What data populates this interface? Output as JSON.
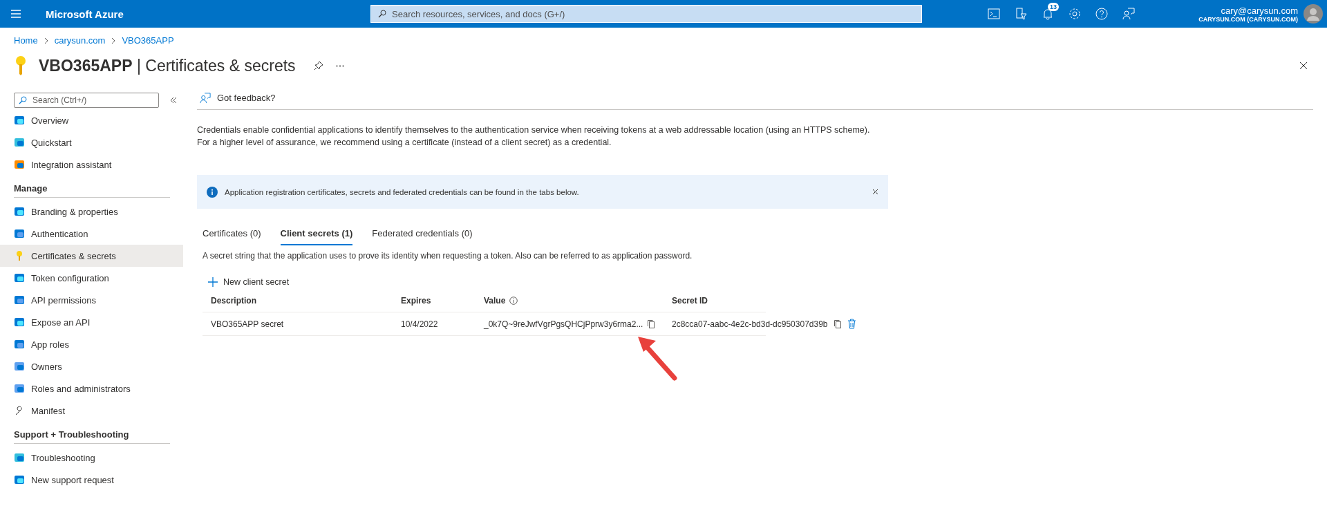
{
  "topbar": {
    "brand": "Microsoft Azure",
    "search_placeholder": "Search resources, services, and docs (G+/)",
    "notification_count": "13",
    "user": {
      "email": "cary@carysun.com",
      "tenant": "CARYSUN.COM (CARYSUN.COM)"
    }
  },
  "breadcrumb": [
    "Home",
    "carysun.com",
    "VBO365APP"
  ],
  "title": {
    "app": "VBO365APP",
    "separator": "|",
    "page": "Certificates & secrets"
  },
  "sidebar": {
    "search_placeholder": "Search (Ctrl+/)",
    "groups": [
      {
        "items": [
          {
            "label": "Overview",
            "selected": false
          },
          {
            "label": "Quickstart",
            "selected": false
          },
          {
            "label": "Integration assistant",
            "selected": false
          }
        ]
      },
      {
        "heading": "Manage",
        "items": [
          {
            "label": "Branding & properties",
            "selected": false
          },
          {
            "label": "Authentication",
            "selected": false
          },
          {
            "label": "Certificates & secrets",
            "selected": true
          },
          {
            "label": "Token configuration",
            "selected": false
          },
          {
            "label": "API permissions",
            "selected": false
          },
          {
            "label": "Expose an API",
            "selected": false
          },
          {
            "label": "App roles",
            "selected": false
          },
          {
            "label": "Owners",
            "selected": false
          },
          {
            "label": "Roles and administrators",
            "selected": false
          },
          {
            "label": "Manifest",
            "selected": false
          }
        ]
      },
      {
        "heading": "Support + Troubleshooting",
        "items": [
          {
            "label": "Troubleshooting",
            "selected": false
          },
          {
            "label": "New support request",
            "selected": false
          }
        ]
      }
    ]
  },
  "feedback": "Got feedback?",
  "description": "Credentials enable confidential applications to identify themselves to the authentication service when receiving tokens at a web addressable location (using an HTTPS scheme). For a higher level of assurance, we recommend using a certificate (instead of a client secret) as a credential.",
  "info_banner": "Application registration certificates, secrets and federated credentials can be found in the tabs below.",
  "tabs": [
    {
      "label": "Certificates (0)",
      "selected": false
    },
    {
      "label": "Client secrets (1)",
      "selected": true
    },
    {
      "label": "Federated credentials (0)",
      "selected": false
    }
  ],
  "tab_description": "A secret string that the application uses to prove its identity when requesting a token. Also can be referred to as application password.",
  "new_button": "New client secret",
  "table": {
    "columns": [
      "Description",
      "Expires",
      "Value",
      "Secret ID"
    ],
    "rows": [
      {
        "description": "VBO365APP secret",
        "expires": "10/4/2022",
        "value": "_0k7Q~9reJwfVgrPgsQHCjPprw3y6rma2...",
        "secret_id": "2c8cca07-aabc-4e2c-bd3d-dc950307d39b"
      }
    ]
  }
}
